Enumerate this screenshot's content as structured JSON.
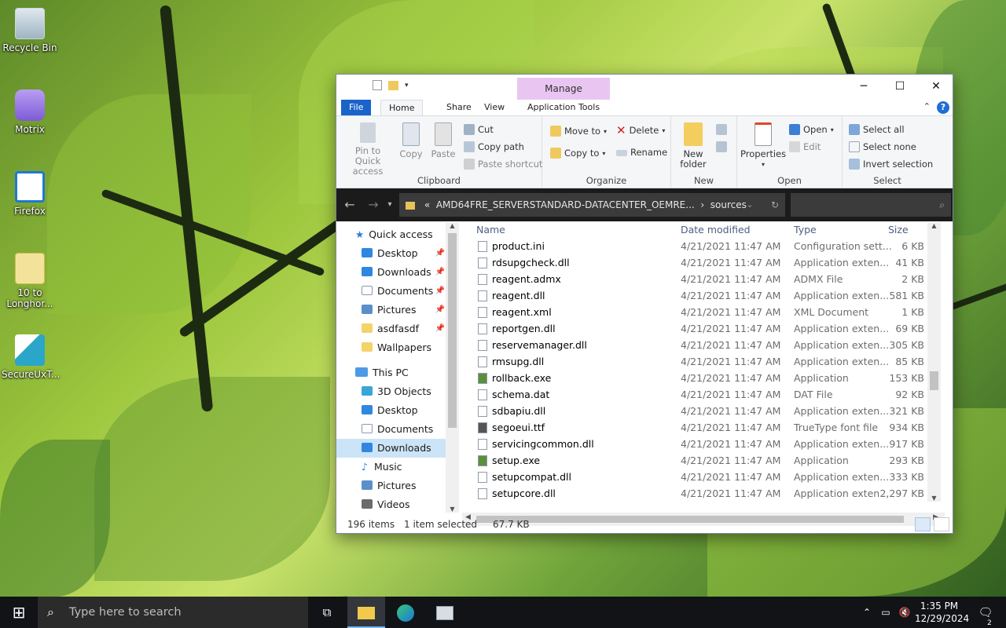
{
  "desktop": {
    "icons": [
      {
        "label": "Recycle Bin",
        "icon": "recycle-bin-icon"
      },
      {
        "label": "Motrix",
        "icon": "motrix-icon"
      },
      {
        "label": "Firefox",
        "icon": "firefox-icon"
      },
      {
        "label": "10 to Longhor...",
        "icon": "folder-icon"
      },
      {
        "label": "SecureUxT...",
        "icon": "secureux-icon"
      }
    ]
  },
  "window": {
    "context_tab": "Manage",
    "controls": {
      "minimize": "─",
      "maximize": "☐",
      "close": "✕"
    },
    "tabs": [
      "File",
      "Home",
      "Share",
      "View",
      "Application Tools"
    ],
    "help_label": "?"
  },
  "ribbon": {
    "clipboard": {
      "pin_label": "Pin to Quick access",
      "copy_label": "Copy",
      "paste_label": "Paste",
      "cut_label": "Cut",
      "copy_path_label": "Copy path",
      "paste_shortcut_label": "Paste shortcut",
      "group_label": "Clipboard"
    },
    "organize": {
      "move_to_label": "Move to",
      "copy_to_label": "Copy to",
      "delete_label": "Delete",
      "rename_label": "Rename",
      "group_label": "Organize"
    },
    "new": {
      "new_folder_label": "New folder",
      "group_label": "New"
    },
    "open": {
      "properties_label": "Properties",
      "open_label": "Open",
      "edit_label": "Edit",
      "group_label": "Open"
    },
    "select": {
      "select_all_label": "Select all",
      "select_none_label": "Select none",
      "invert_selection_label": "Invert selection",
      "group_label": "Select"
    }
  },
  "address": {
    "prefix": "«",
    "crumbs": [
      "AMD64FRE_SERVERSTANDARD-DATACENTER_OEMRE...",
      "sources"
    ],
    "separator": "›"
  },
  "nav": {
    "quick_access": "Quick access",
    "items": [
      {
        "label": "Desktop",
        "pinned": true
      },
      {
        "label": "Downloads",
        "pinned": true
      },
      {
        "label": "Documents",
        "pinned": true
      },
      {
        "label": "Pictures",
        "pinned": true
      },
      {
        "label": "asdfasdf",
        "pinned": true
      },
      {
        "label": "Wallpapers",
        "pinned": false
      }
    ],
    "this_pc": "This PC",
    "pc_items": [
      "3D Objects",
      "Desktop",
      "Documents",
      "Downloads",
      "Music",
      "Pictures",
      "Videos"
    ],
    "selected": "Downloads"
  },
  "columns": {
    "name": "Name",
    "date": "Date modified",
    "type": "Type",
    "size": "Size"
  },
  "files": [
    {
      "name": "product.ini",
      "date": "4/21/2021 11:47 AM",
      "type": "Configuration sett...",
      "size": "6 KB"
    },
    {
      "name": "rdsupgcheck.dll",
      "date": "4/21/2021 11:47 AM",
      "type": "Application exten...",
      "size": "41 KB"
    },
    {
      "name": "reagent.admx",
      "date": "4/21/2021 11:47 AM",
      "type": "ADMX File",
      "size": "2 KB"
    },
    {
      "name": "reagent.dll",
      "date": "4/21/2021 11:47 AM",
      "type": "Application exten...",
      "size": "581 KB"
    },
    {
      "name": "reagent.xml",
      "date": "4/21/2021 11:47 AM",
      "type": "XML Document",
      "size": "1 KB"
    },
    {
      "name": "reportgen.dll",
      "date": "4/21/2021 11:47 AM",
      "type": "Application exten...",
      "size": "69 KB"
    },
    {
      "name": "reservemanager.dll",
      "date": "4/21/2021 11:47 AM",
      "type": "Application exten...",
      "size": "305 KB"
    },
    {
      "name": "rmsupg.dll",
      "date": "4/21/2021 11:47 AM",
      "type": "Application exten...",
      "size": "85 KB"
    },
    {
      "name": "rollback.exe",
      "date": "4/21/2021 11:47 AM",
      "type": "Application",
      "size": "153 KB"
    },
    {
      "name": "schema.dat",
      "date": "4/21/2021 11:47 AM",
      "type": "DAT File",
      "size": "92 KB"
    },
    {
      "name": "sdbapiu.dll",
      "date": "4/21/2021 11:47 AM",
      "type": "Application exten...",
      "size": "321 KB"
    },
    {
      "name": "segoeui.ttf",
      "date": "4/21/2021 11:47 AM",
      "type": "TrueType font file",
      "size": "934 KB"
    },
    {
      "name": "servicingcommon.dll",
      "date": "4/21/2021 11:47 AM",
      "type": "Application exten...",
      "size": "917 KB"
    },
    {
      "name": "setup.exe",
      "date": "4/21/2021 11:47 AM",
      "type": "Application",
      "size": "293 KB"
    },
    {
      "name": "setupcompat.dll",
      "date": "4/21/2021 11:47 AM",
      "type": "Application exten...",
      "size": "333 KB"
    },
    {
      "name": "setupcore.dll",
      "date": "4/21/2021 11:47 AM",
      "type": "Application exten...",
      "size": "2,297 KB"
    }
  ],
  "status": {
    "count": "196 items",
    "selected": "1 item selected",
    "size": "67.7 KB"
  },
  "taskbar": {
    "search_placeholder": "Type here to search",
    "time": "1:35 PM",
    "date": "12/29/2024",
    "notification_count": "2"
  },
  "colors": {
    "accent": "#1a64c9",
    "manage_tab": "#e9c6f2",
    "selection": "#cce4f7",
    "taskbar": "#111317"
  }
}
